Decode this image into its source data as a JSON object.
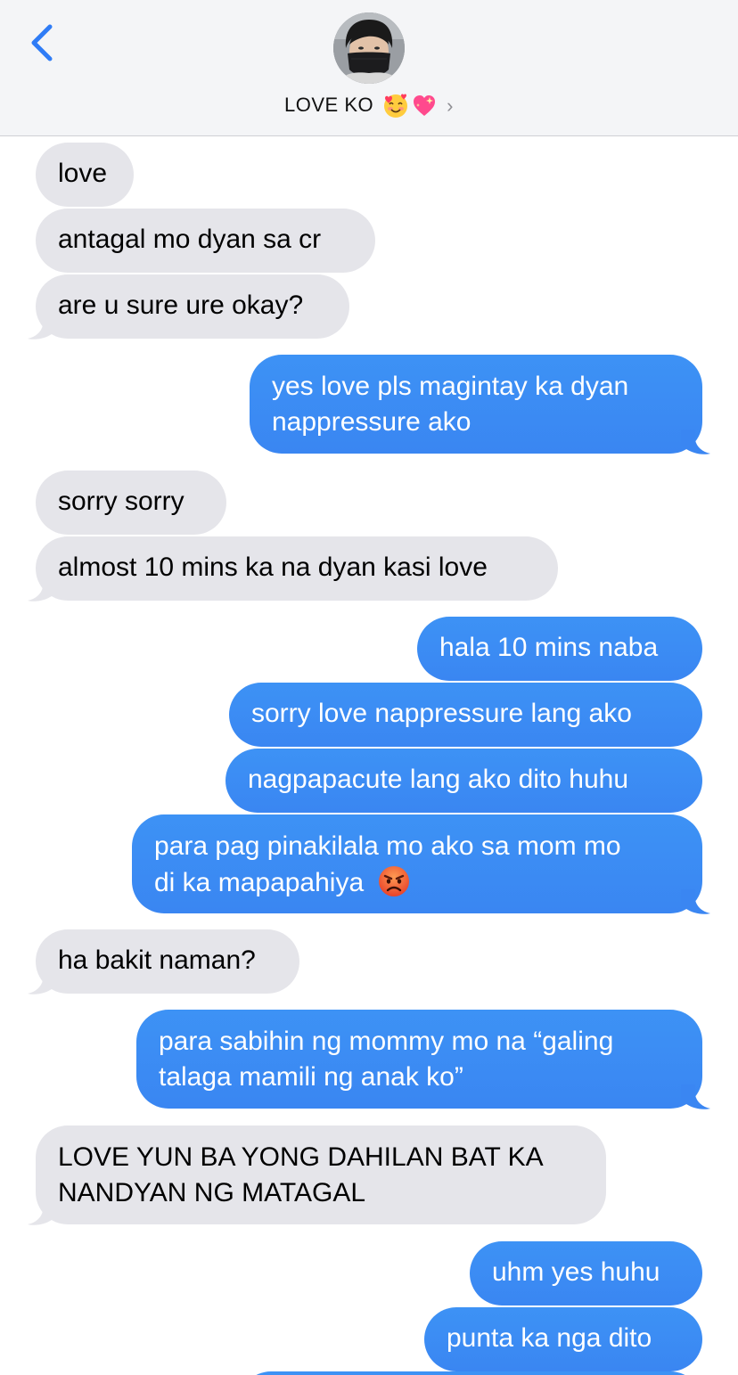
{
  "header": {
    "contact_name": "LOVE KO",
    "emoji_1": "smiling-face-with-hearts",
    "emoji_2": "sparkling-heart",
    "chevron": "›"
  },
  "messages": [
    {
      "from": "them",
      "text": "love"
    },
    {
      "from": "them",
      "text": "antagal mo dyan sa cr"
    },
    {
      "from": "them",
      "text": "are u sure ure okay?"
    },
    {
      "from": "me",
      "lines": [
        "yes love pls magintay ka dyan",
        "nappressure ako"
      ]
    },
    {
      "from": "them",
      "text": "sorry sorry"
    },
    {
      "from": "them",
      "text": "almost 10 mins ka na dyan kasi love"
    },
    {
      "from": "me",
      "text": "hala 10 mins naba"
    },
    {
      "from": "me",
      "text": "sorry love nappressure lang ako"
    },
    {
      "from": "me",
      "text": "nagpapacute lang ako dito huhu"
    },
    {
      "from": "me",
      "lines": [
        "para pag pinakilala mo ako sa mom mo",
        "di ka mapapahiya"
      ],
      "emoji": "angry-face"
    },
    {
      "from": "them",
      "text": "ha bakit naman?"
    },
    {
      "from": "me",
      "lines": [
        "para sabihin ng mommy mo na “galing",
        "talaga mamili ng anak ko”"
      ]
    },
    {
      "from": "them",
      "lines": [
        "LOVE YUN BA YONG DAHILAN BAT KA",
        "NANDYAN NG MATAGAL"
      ]
    },
    {
      "from": "me",
      "text": "uhm yes huhu"
    },
    {
      "from": "me",
      "text": "punta ka nga dito"
    }
  ],
  "colors": {
    "incoming_bubble": "#e5e5ea",
    "outgoing_bubble": "#3a88f3",
    "header_bg": "#f4f5f7",
    "accent": "#2f7cf6"
  }
}
